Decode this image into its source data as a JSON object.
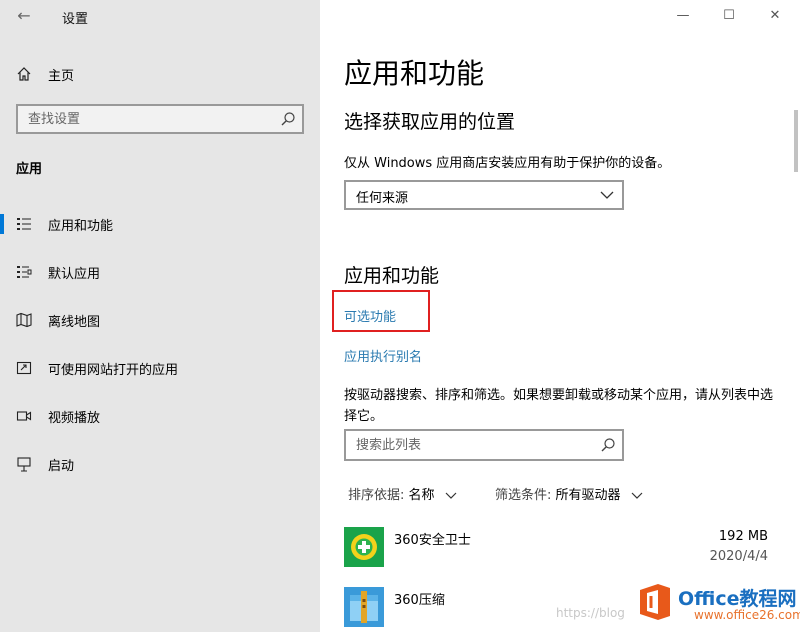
{
  "window": {
    "title": "设置",
    "back_glyph": "←",
    "minimize_glyph": "—",
    "maximize_glyph": "☐",
    "close_glyph": "✕"
  },
  "sidebar": {
    "home_label": "主页",
    "search_placeholder": "查找设置",
    "section": "应用",
    "items": [
      {
        "label": "应用和功能",
        "icon": "apps-features-icon",
        "selected": true
      },
      {
        "label": "默认应用",
        "icon": "default-apps-icon",
        "selected": false
      },
      {
        "label": "离线地图",
        "icon": "offline-maps-icon",
        "selected": false
      },
      {
        "label": "可使用网站打开的应用",
        "icon": "apps-for-websites-icon",
        "selected": false
      },
      {
        "label": "视频播放",
        "icon": "video-playback-icon",
        "selected": false
      },
      {
        "label": "启动",
        "icon": "startup-icon",
        "selected": false
      }
    ]
  },
  "main": {
    "title": "应用和功能",
    "install_heading": "选择获取应用的位置",
    "install_desc": "仅从 Windows 应用商店安装应用有助于保护你的设备。",
    "install_source": "任何来源",
    "apps_heading": "应用和功能",
    "optional_features_link": "可选功能",
    "aliases_link": "应用执行别名",
    "list_desc": "按驱动器搜索、排序和筛选。如果想要卸载或移动某个应用，请从列表中选择它。",
    "list_search_placeholder": "搜索此列表",
    "sort_key": "排序依据:",
    "sort_value": "名称",
    "filter_key": "筛选条件:",
    "filter_value": "所有驱动器",
    "apps": [
      {
        "name": "360安全卫士",
        "size": "192 MB",
        "date": "2020/4/4"
      },
      {
        "name": "360压缩",
        "size": "",
        "date": ""
      }
    ]
  },
  "watermark": {
    "url": "https://blog",
    "brand_name": "Office教程网",
    "brand_domain": "www.office26.com"
  },
  "colors": {
    "accent": "#0078d7",
    "link": "#2a7ab0",
    "highlight": "#e02020",
    "sidebar_bg": "#e6e6e6"
  }
}
